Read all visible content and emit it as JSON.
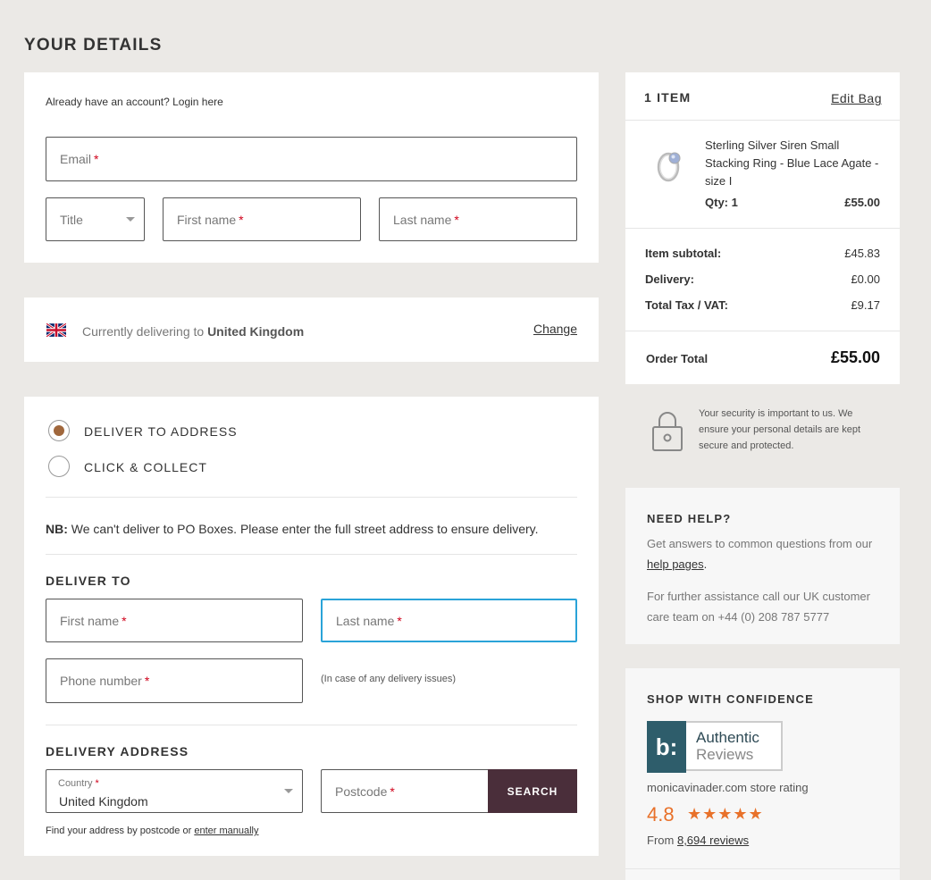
{
  "page_title": "YOUR DETAILS",
  "account": {
    "login_prompt": "Already have an account? Login here",
    "email_placeholder": "Email",
    "title_placeholder": "Title",
    "first_name_placeholder": "First name",
    "last_name_placeholder": "Last name",
    "required_mark": "*"
  },
  "delivery_country": {
    "prefix": "Currently delivering to",
    "country": "United Kingdom",
    "change_label": "Change",
    "flag_icon": "uk-flag-icon"
  },
  "delivery_options": {
    "deliver_label": "DELIVER TO ADDRESS",
    "collect_label": "CLICK & COLLECT",
    "selected": "deliver",
    "note_bold": "NB:",
    "note_text": "We can't deliver to PO Boxes. Please enter the full street address to ensure delivery."
  },
  "deliver_to": {
    "heading": "DELIVER TO",
    "first_name_placeholder": "First name",
    "last_name_placeholder": "Last name",
    "phone_placeholder": "Phone number",
    "phone_hint": "(In case of any delivery issues)"
  },
  "delivery_address": {
    "heading": "DELIVERY ADDRESS",
    "country_label": "Country",
    "country_value": "United Kingdom",
    "postcode_placeholder": "Postcode",
    "search_label": "SEARCH",
    "find_text": "Find your address by postcode or",
    "manual_link": "enter manually"
  },
  "bag": {
    "count_label": "1 ITEM",
    "edit_label": "Edit Bag",
    "item_name": "Sterling Silver Siren Small Stacking Ring - Blue Lace Agate - size I",
    "item_qty": "Qty: 1",
    "item_price": "£55.00",
    "subtotal_label": "Item subtotal:",
    "subtotal_value": "£45.83",
    "delivery_label": "Delivery:",
    "delivery_value": "£0.00",
    "tax_label": "Total Tax / VAT:",
    "tax_value": "£9.17",
    "total_label": "Order Total",
    "total_value": "£55.00"
  },
  "security": {
    "text": "Your security is important to us. We ensure your personal details are kept secure and protected.",
    "icon": "padlock-icon"
  },
  "help": {
    "heading": "NEED HELP?",
    "text1": "Get answers to common questions from our",
    "link": "help pages",
    "link_suffix": ".",
    "text2": "For further assistance call our UK customer care team on +44 (0) 208 787 5777"
  },
  "confidence": {
    "heading": "SHOP WITH CONFIDENCE",
    "badge_mark": "b:",
    "badge_line1": "Authentic",
    "badge_line2": "Reviews",
    "store_rating_label": "monicavinader.com store rating",
    "rating": "4.8",
    "stars": "★★★★★",
    "from_label": "From",
    "reviews_link": "8,694 reviews"
  },
  "colors": {
    "accent_brown": "#a0673c",
    "search_button": "#4a2e3a",
    "focus_border": "#2aa3d8",
    "rating_orange": "#e8712a",
    "badge_teal": "#2e5d6b"
  }
}
